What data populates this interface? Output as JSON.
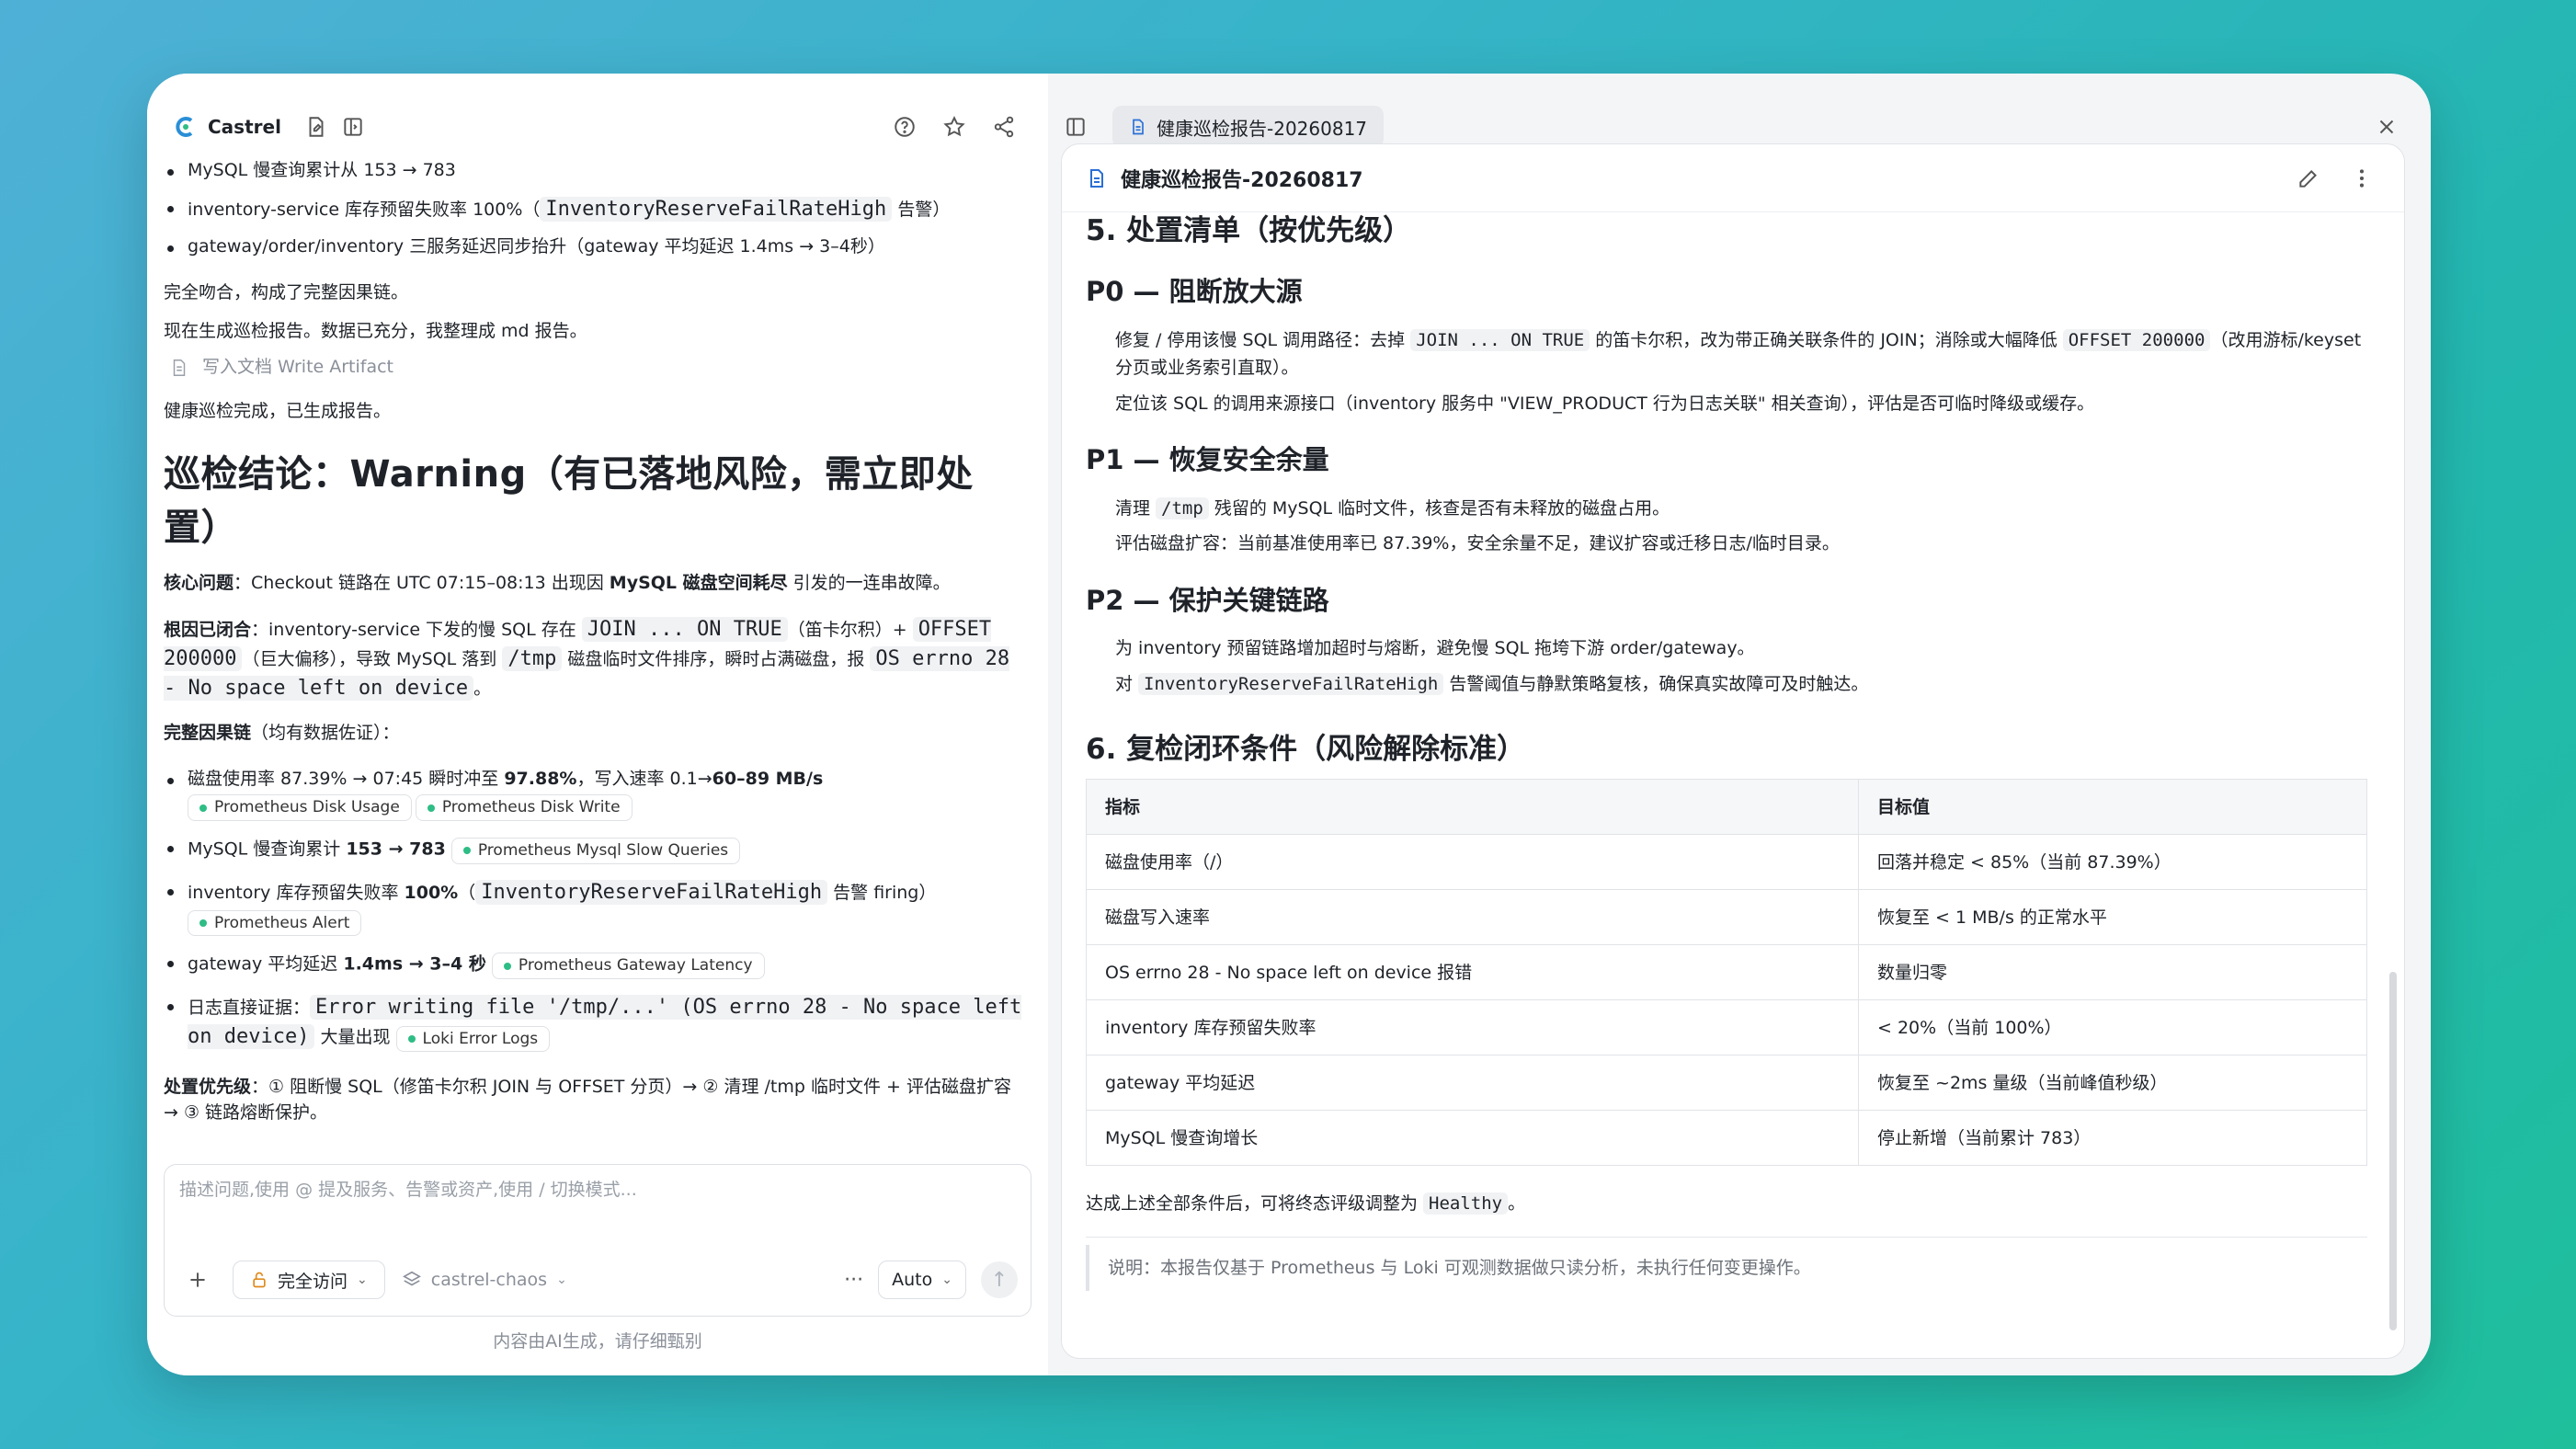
{
  "app": {
    "name": "Castrel"
  },
  "left": {
    "intro_bullets": [
      "MySQL 慢查询累计从 153 → 783",
      [
        "inventory-service 库存预留失败率 100%（",
        "InventoryReserveFailRateHigh",
        " 告警）"
      ],
      "gateway/order/inventory 三服务延迟同步抬升（gateway 平均延迟 1.4ms → 3–4秒）"
    ],
    "p1": "完全吻合，构成了完整因果链。",
    "p2": "现在生成巡检报告。数据已充分，我整理成 md 报告。",
    "tool_call": "写入文档 Write Artifact",
    "p3": "健康巡检完成，已生成报告。",
    "heading": "巡检结论：Warning（有已落地风险，需立即处置）",
    "core": {
      "label": "核心问题",
      "a": "：Checkout 链路在 UTC 07:15–08:13 出现因 ",
      "b": "MySQL 磁盘空间耗尽",
      "c": " 引发的一连串故障。"
    },
    "root": {
      "label": "根因已闭合",
      "a": "：inventory-service 下发的慢 SQL 存在 ",
      "c1": "JOIN ... ON TRUE",
      "b": "（笛卡尔积）+ ",
      "c2": "OFFSET 200000",
      "c": "（巨大偏移），导致 MySQL 落到 ",
      "c3": "/tmp",
      "d": " 磁盘临时文件排序，瞬时占满磁盘，报 ",
      "c4": "OS errno 28 - No space left on device",
      "e": "。"
    },
    "chain_label": "完整因果链",
    "chain_note": "（均有数据佐证）：",
    "chain": [
      {
        "a": "磁盘使用率 87.39% → 07:45 瞬时冲至 ",
        "b": "97.88%",
        "c": "，写入速率 0.1→",
        "d": "60–89 MB/s",
        "tags": [
          "Prometheus Disk Usage",
          "Prometheus Disk Write"
        ]
      },
      {
        "a": "MySQL 慢查询累计 ",
        "b": "153 → 783",
        "tags": [
          "Prometheus Mysql Slow Queries"
        ]
      },
      {
        "a": "inventory 库存预留失败率 ",
        "b": "100%",
        "c": "（",
        "code": "InventoryReserveFailRateHigh",
        "d": " 告警 firing）",
        "tags": [
          "Prometheus Alert"
        ]
      },
      {
        "a": "gateway 平均延迟 ",
        "b": "1.4ms → 3–4 秒",
        "tags": [
          "Prometheus Gateway Latency"
        ]
      },
      {
        "a": "日志直接证据：",
        "code": "Error writing file '/tmp/...' (OS errno 28 - No space left on device)",
        "d": " 大量出现",
        "tags": [
          "Loki Error Logs"
        ]
      }
    ],
    "priority_label": "处置优先级",
    "priority_text": "：① 阻断慢 SQL（修笛卡尔积 JOIN 与 OFFSET 分页）→ ② 清理 /tmp 临时文件 + 评估磁盘扩容 → ③ 链路熔断保护。",
    "input": {
      "placeholder": "描述问题,使用 @ 提及服务、告警或资产,使用 / 切换模式...",
      "access": "完全访问",
      "workspace": "castrel-chaos",
      "more": "···",
      "mode": "Auto"
    },
    "footer": "内容由AI生成，请仔细甄别"
  },
  "right": {
    "tab_title": "健康巡检报告-20260817",
    "doc_title": "健康巡检报告-20260817",
    "s5": "5. 处置清单（按优先级）",
    "p0": {
      "title": "P0 — 阻断放大源",
      "l1": [
        "修复 / 停用该慢 SQL 调用路径：去掉 ",
        "JOIN ... ON TRUE",
        " 的笛卡尔积，改为带正确关联条件的 JOIN；消除或大幅降低 ",
        "OFFSET 200000",
        "（改用游标/keyset 分页或业务索引直取）。"
      ],
      "l2": "定位该 SQL 的调用来源接口（inventory 服务中 \"VIEW_PRODUCT 行为日志关联\" 相关查询），评估是否可临时降级或缓存。"
    },
    "p1": {
      "title": "P1 — 恢复安全余量",
      "l1": [
        "清理 ",
        "/tmp",
        " 残留的 MySQL 临时文件，核查是否有未释放的磁盘占用。"
      ],
      "l2": "评估磁盘扩容：当前基准使用率已 87.39%，安全余量不足，建议扩容或迁移日志/临时目录。"
    },
    "p2": {
      "title": "P2 — 保护关键链路",
      "l1": "为 inventory 预留链路增加超时与熔断，避免慢 SQL 拖垮下游 order/gateway。",
      "l2": [
        "对 ",
        "InventoryReserveFailRateHigh",
        " 告警阈值与静默策略复核，确保真实故障可及时触达。"
      ]
    },
    "s6": "6. 复检闭环条件（风险解除标准）",
    "table": {
      "headers": [
        "指标",
        "目标值"
      ],
      "rows": [
        [
          "磁盘使用率（/）",
          "回落并稳定 < 85%（当前 87.39%）"
        ],
        [
          "磁盘写入速率",
          "恢复至 < 1 MB/s 的正常水平"
        ],
        [
          "OS errno 28 - No space left on device 报错",
          "数量归零"
        ],
        [
          "inventory 库存预留失败率",
          "< 20%（当前 100%）"
        ],
        [
          "gateway 平均延迟",
          "恢复至 ~2ms 量级（当前峰值秒级）"
        ],
        [
          "MySQL 慢查询增长",
          "停止新增（当前累计 783）"
        ]
      ]
    },
    "after": [
      "达成上述全部条件后，可将终态评级调整为 ",
      "Healthy",
      "。"
    ],
    "note": "说明：本报告仅基于 Prometheus 与 Loki 可观测数据做只读分析，未执行任何变更操作。"
  }
}
